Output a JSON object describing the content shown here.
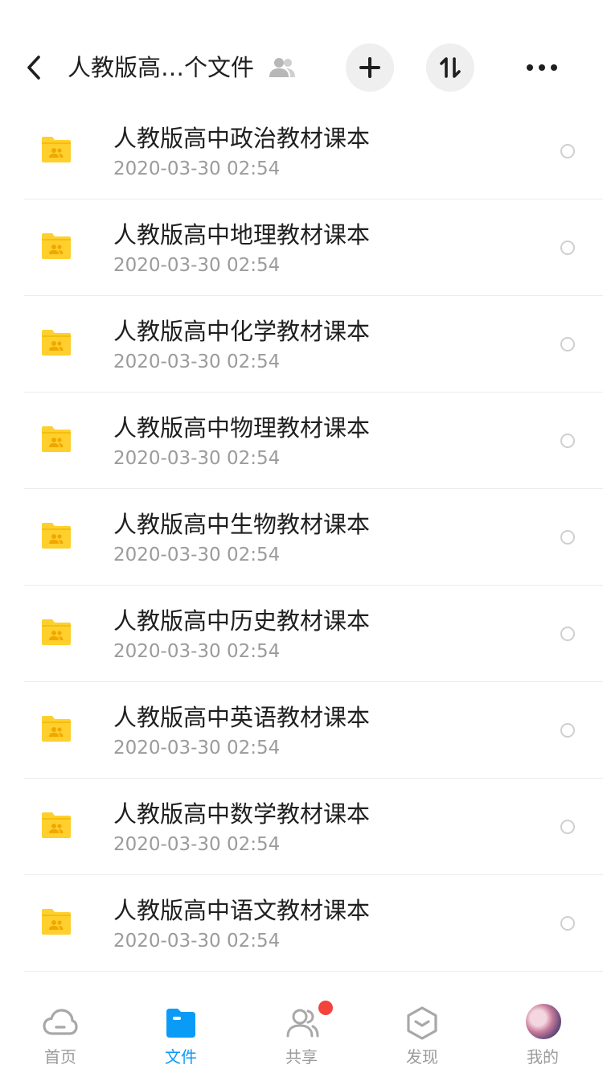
{
  "header": {
    "title": "人教版高…个文件"
  },
  "files": [
    {
      "name": "人教版高中政治教材课本",
      "time": "2020-03-30 02:54"
    },
    {
      "name": "人教版高中地理教材课本",
      "time": "2020-03-30 02:54"
    },
    {
      "name": "人教版高中化学教材课本",
      "time": "2020-03-30 02:54"
    },
    {
      "name": "人教版高中物理教材课本",
      "time": "2020-03-30 02:54"
    },
    {
      "name": "人教版高中生物教材课本",
      "time": "2020-03-30 02:54"
    },
    {
      "name": "人教版高中历史教材课本",
      "time": "2020-03-30 02:54"
    },
    {
      "name": "人教版高中英语教材课本",
      "time": "2020-03-30 02:54"
    },
    {
      "name": "人教版高中数学教材课本",
      "time": "2020-03-30 02:54"
    },
    {
      "name": "人教版高中语文教材课本",
      "time": "2020-03-30 02:54"
    }
  ],
  "tabs": [
    {
      "label": "首页",
      "icon": "cloud-icon"
    },
    {
      "label": "文件",
      "icon": "folder-icon",
      "active": true
    },
    {
      "label": "共享",
      "icon": "people-icon",
      "badge": true
    },
    {
      "label": "发现",
      "icon": "discover-icon"
    },
    {
      "label": "我的",
      "icon": "avatar"
    }
  ],
  "colors": {
    "accent": "#0a9bf7",
    "folder": "#ffcf2e",
    "badge": "#f4433c",
    "secondary_text": "#9b9b9b"
  }
}
